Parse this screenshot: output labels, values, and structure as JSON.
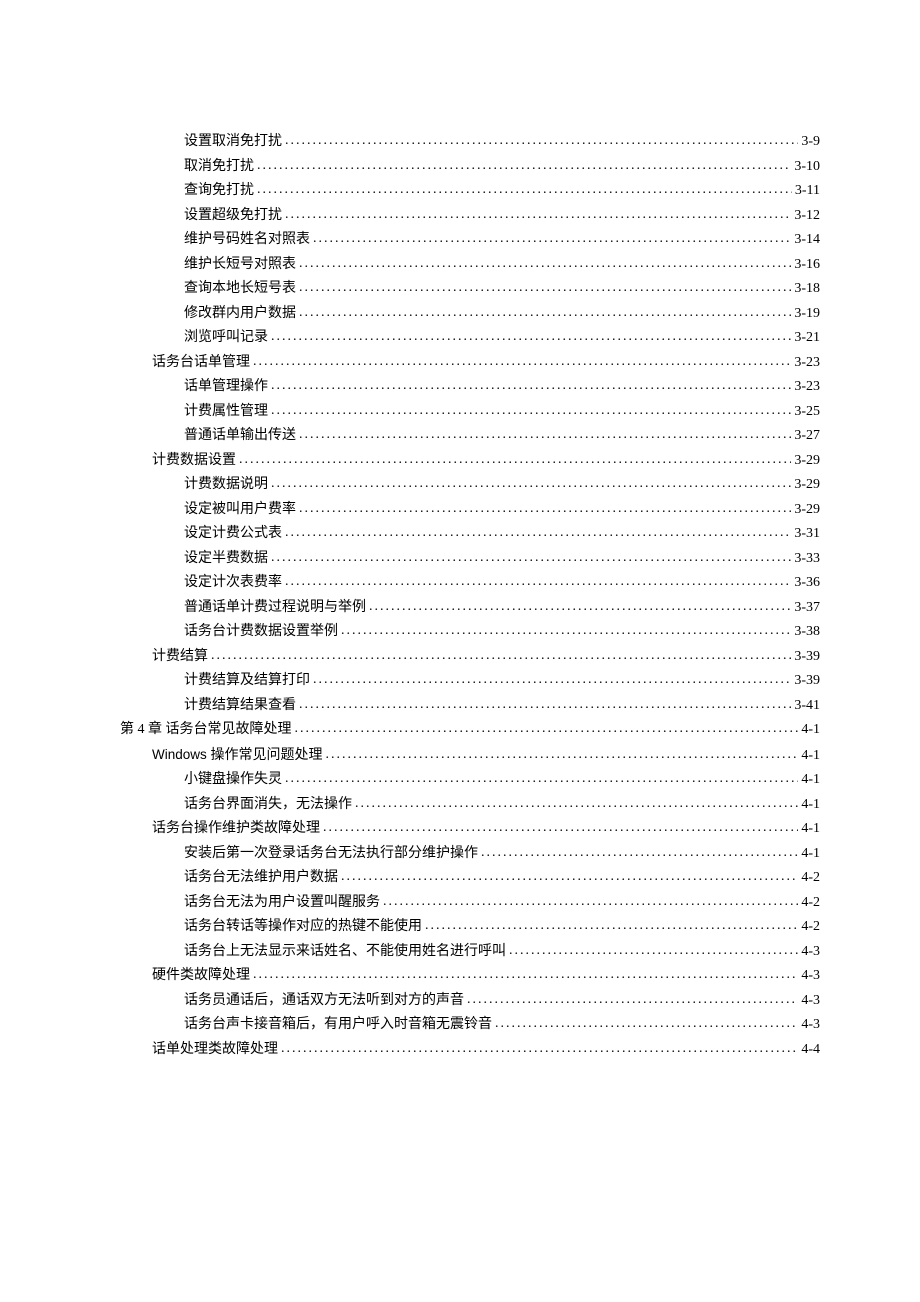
{
  "toc": [
    {
      "level": 3,
      "title": "设置取消免打扰",
      "page": "3-9"
    },
    {
      "level": 3,
      "title": "取消免打扰",
      "page": "3-10"
    },
    {
      "level": 3,
      "title": "查询免打扰",
      "page": "3-11"
    },
    {
      "level": 3,
      "title": "设置超级免打扰",
      "page": "3-12"
    },
    {
      "level": 3,
      "title": "维护号码姓名对照表",
      "page": "3-14"
    },
    {
      "level": 3,
      "title": "维护长短号对照表",
      "page": "3-16"
    },
    {
      "level": 3,
      "title": "查询本地长短号表",
      "page": "3-18"
    },
    {
      "level": 3,
      "title": "修改群内用户数据",
      "page": "3-19"
    },
    {
      "level": 3,
      "title": "浏览呼叫记录",
      "page": "3-21"
    },
    {
      "level": 2,
      "title": "话务台话单管理",
      "page": "3-23"
    },
    {
      "level": 3,
      "title": "话单管理操作",
      "page": "3-23"
    },
    {
      "level": 3,
      "title": "计费属性管理",
      "page": "3-25"
    },
    {
      "level": 3,
      "title": "普通话单输出传送",
      "page": "3-27"
    },
    {
      "level": 2,
      "title": "计费数据设置",
      "page": "3-29"
    },
    {
      "level": 3,
      "title": "计费数据说明",
      "page": "3-29"
    },
    {
      "level": 3,
      "title": "设定被叫用户费率",
      "page": "3-29"
    },
    {
      "level": 3,
      "title": "设定计费公式表",
      "page": "3-31"
    },
    {
      "level": 3,
      "title": "设定半费数据",
      "page": "3-33"
    },
    {
      "level": 3,
      "title": "设定计次表费率",
      "page": "3-36"
    },
    {
      "level": 3,
      "title": "普通话单计费过程说明与举例",
      "page": "3-37"
    },
    {
      "level": 3,
      "title": "话务台计费数据设置举例",
      "page": "3-38"
    },
    {
      "level": 2,
      "title": "计费结算",
      "page": "3-39"
    },
    {
      "level": 3,
      "title": "计费结算及结算打印",
      "page": "3-39"
    },
    {
      "level": 3,
      "title": "计费结算结果查看",
      "page": "3-41"
    },
    {
      "level": 1,
      "title": "第 4 章 话务台常见故障处理",
      "page": "4-1"
    },
    {
      "level": 2,
      "title": "Windows 操作常见问题处理",
      "page": "4-1",
      "latin_prefix": true
    },
    {
      "level": 3,
      "title": "小键盘操作失灵",
      "page": "4-1"
    },
    {
      "level": 3,
      "title": "话务台界面消失，无法操作",
      "page": "4-1"
    },
    {
      "level": 2,
      "title": "话务台操作维护类故障处理",
      "page": "4-1"
    },
    {
      "level": 3,
      "title": "安装后第一次登录话务台无法执行部分维护操作",
      "page": "4-1"
    },
    {
      "level": 3,
      "title": "话务台无法维护用户数据",
      "page": "4-2"
    },
    {
      "level": 3,
      "title": "话务台无法为用户设置叫醒服务",
      "page": "4-2"
    },
    {
      "level": 3,
      "title": "话务台转话等操作对应的热键不能使用",
      "page": "4-2"
    },
    {
      "level": 3,
      "title": "话务台上无法显示来话姓名、不能使用姓名进行呼叫",
      "page": "4-3"
    },
    {
      "level": 2,
      "title": "硬件类故障处理",
      "page": "4-3"
    },
    {
      "level": 3,
      "title": "话务员通话后，通话双方无法听到对方的声音",
      "page": "4-3"
    },
    {
      "level": 3,
      "title": "话务台声卡接音箱后，有用户呼入时音箱无震铃音",
      "page": "4-3"
    },
    {
      "level": 2,
      "title": "话单处理类故障处理",
      "page": "4-4"
    }
  ]
}
